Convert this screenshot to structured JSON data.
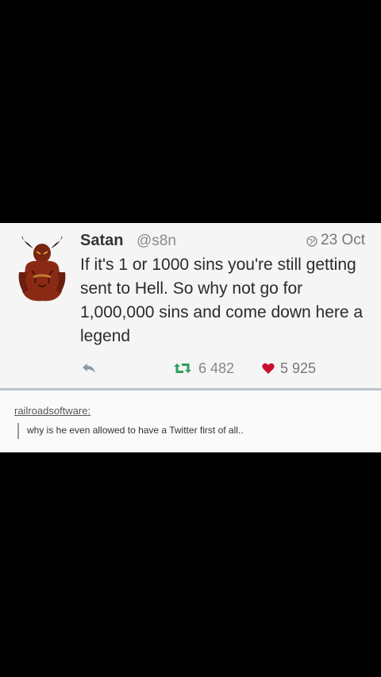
{
  "tweet": {
    "author_name": "Satan",
    "handle": "@s8n",
    "date": "23 Oct",
    "text": "If it's 1 or 1000 sins you're still getting sent to Hell. So why not go for 1,000,000 sins and come down here a legend",
    "retweets": "6 482",
    "likes": "5 925"
  },
  "reblog": {
    "username": "railroadsoftware:",
    "comment": "why is he even allowed to have a Twitter first of all.."
  },
  "colors": {
    "background": "#000000",
    "tweet_bg": "#f5f5f5",
    "retweet": "#2f9e5a",
    "heart": "#c8102e"
  },
  "icons": {
    "avatar": "devil-avatar",
    "globe": "globe-icon",
    "reply": "reply-icon",
    "retweet": "retweet-icon",
    "like": "heart-icon"
  }
}
